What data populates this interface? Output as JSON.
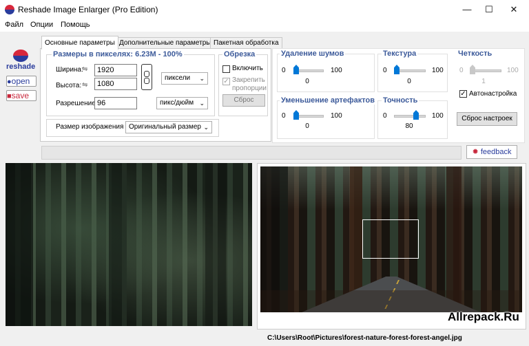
{
  "window": {
    "title": "Reshade Image Enlarger (Pro Edition)"
  },
  "menu": [
    "Файл",
    "Опции",
    "Помощь"
  ],
  "side_buttons": {
    "logo": "reshade",
    "open": "open",
    "save": "save"
  },
  "tabs": [
    "Основные параметры",
    "Дополнительные параметры",
    "Пакетная обработка"
  ],
  "size": {
    "title": "Размеры в пикселях:  6.23M - 100%",
    "width_label": "Ширина:",
    "width_value": "1920",
    "height_label": "Высота:",
    "height_value": "1080",
    "unit": "пиксели",
    "resolution_label": "Разрешение",
    "resolution_value": "96",
    "resolution_unit": "пикс/дюйм",
    "image_size_label": "Размер изображения",
    "image_size_value": "Оригинальный размер"
  },
  "crop": {
    "title": "Обрезка",
    "enable_label": "Включить",
    "enable_checked": false,
    "keep_ratio_label": "Закрепить пропорции",
    "keep_ratio_checked": true,
    "reset_label": "Сброс"
  },
  "sliders": [
    {
      "title": "Удаление шумов",
      "min": "0",
      "max": "100",
      "value": "0",
      "level": 0,
      "enabled": true
    },
    {
      "title": "Текстура",
      "min": "0",
      "max": "100",
      "value": "0",
      "level": 0,
      "enabled": true
    },
    {
      "title": "Четкость",
      "min": "0",
      "max": "100",
      "value": "1",
      "level": 1,
      "enabled": false
    },
    {
      "title": "Уменьшение артефактов",
      "min": "0",
      "max": "100",
      "value": "0",
      "level": 0,
      "enabled": true
    },
    {
      "title": "Точность",
      "min": "0",
      "max": "100",
      "value": "80",
      "level": 80,
      "enabled": true
    }
  ],
  "auto_tune": {
    "label": "Автонастройка",
    "checked": true
  },
  "reset_settings_label": "Сброс настроек",
  "feedback_label": "feedback",
  "status": {
    "path": "C:\\Users\\Root\\Pictures\\forest-nature-forest-forest-angel.jpg"
  },
  "watermark": "Allrepack.Ru",
  "colors": {
    "accent": "#0078d7",
    "group_title": "#3c5a9a"
  }
}
